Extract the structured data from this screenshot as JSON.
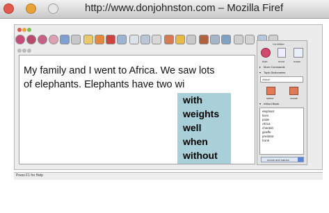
{
  "browser": {
    "title": "http://www.donjohnston.com – Mozilla Firef"
  },
  "document": {
    "lines": [
      "My family and I went to Africa.  We saw lots",
      "of elephants.  Elephants have two wi"
    ]
  },
  "prediction": {
    "words": [
      "with",
      "weights",
      "well",
      "when",
      "without"
    ]
  },
  "panel": {
    "title": "Co:Writer",
    "buttons": [
      "hide",
      "more",
      "erase"
    ],
    "more_commands": "More Commands",
    "topic_dictionaries": "Topic Dictionaries",
    "topic_selected": "Africa*",
    "topic_buttons": [
      "select",
      "create"
    ],
    "word_bank_label": "eWord Bank",
    "word_bank": [
      "elephant",
      "lions",
      "pride",
      "Africa",
      "cheetah",
      "giraffe",
      "predator",
      "trunk"
    ],
    "word_bank_select": "nouns and names"
  },
  "status": {
    "text": "Press F1 for Help"
  }
}
